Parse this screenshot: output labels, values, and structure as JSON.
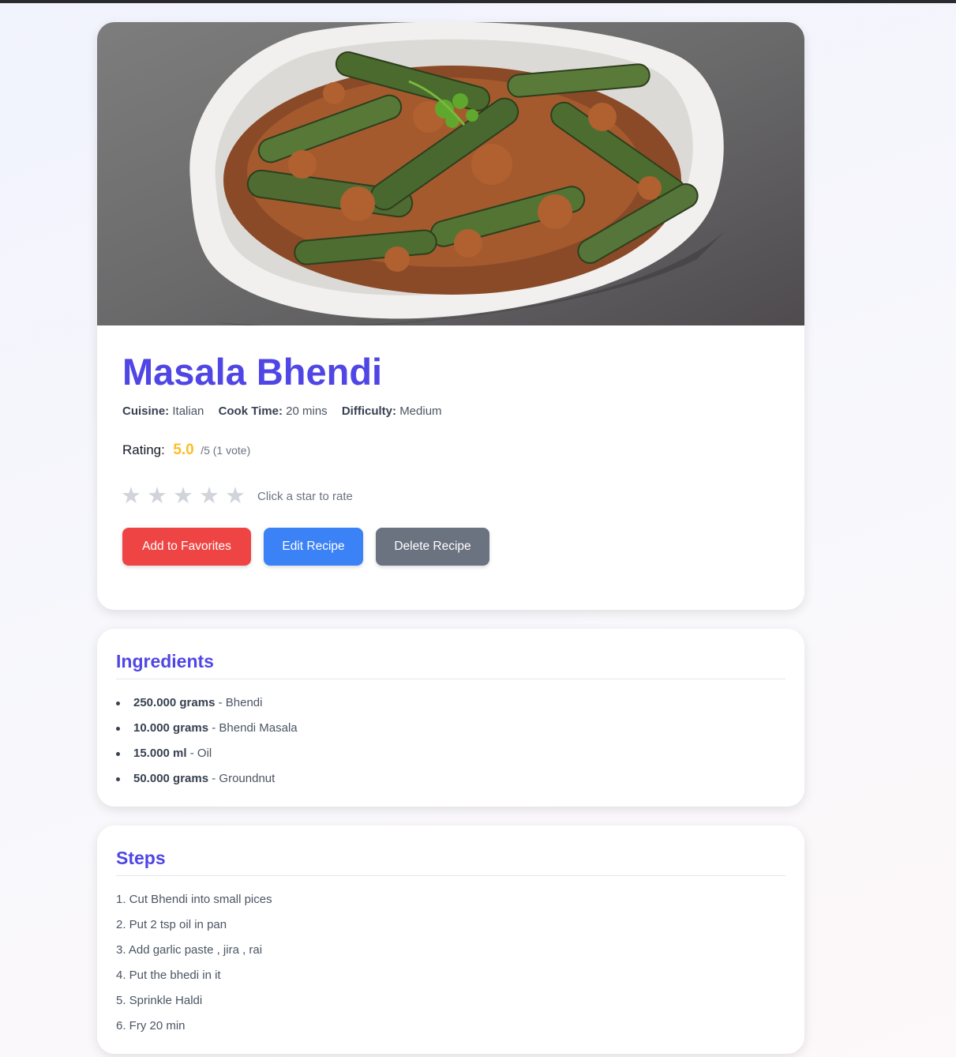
{
  "recipe": {
    "title": "Masala Bhendi",
    "image_alt": "Masala Bhendi",
    "meta": {
      "cuisine_label": "Cuisine:",
      "cuisine": "Italian",
      "cook_time_label": "Cook Time:",
      "cook_time": "20 mins",
      "difficulty_label": "Difficulty:",
      "difficulty": "Medium"
    },
    "rating": {
      "label": "Rating:",
      "score": "5.0",
      "suffix": "/5 (1 vote)",
      "hint": "Click a star to rate"
    },
    "actions": {
      "favorite": "Add to Favorites",
      "edit": "Edit Recipe",
      "delete": "Delete Recipe"
    }
  },
  "ingredients": {
    "title": "Ingredients",
    "items": [
      {
        "qty": "250.000 grams",
        "name": "Bhendi"
      },
      {
        "qty": "10.000 grams",
        "name": "Bhendi Masala"
      },
      {
        "qty": "15.000 ml",
        "name": "Oil"
      },
      {
        "qty": "50.000 grams",
        "name": "Groundnut"
      }
    ]
  },
  "steps": {
    "title": "Steps",
    "items": [
      "1. Cut Bhendi into small pices",
      "2. Put 2 tsp oil in pan",
      "3. Add garlic paste , jira , rai",
      "4. Put the bhedi in it",
      "5. Sprinkle Haldi",
      "6. Fry 20 min"
    ]
  },
  "colors": {
    "accent": "#4f46e5",
    "rating": "#fbbf24",
    "favorite": "#ef4444",
    "edit": "#3b82f6",
    "delete": "#6b7280"
  }
}
